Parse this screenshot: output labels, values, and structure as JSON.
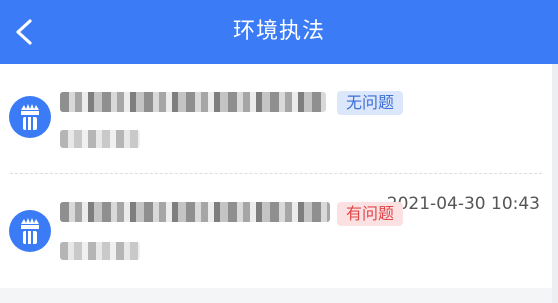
{
  "header": {
    "title": "环境执法"
  },
  "items": [
    {
      "status": "无问题",
      "status_color": "#3b6fd6",
      "time": "2021-04-30 10:43"
    },
    {
      "status": "有问题",
      "status_color": "#e0454a"
    }
  ],
  "colors": {
    "primary": "#3b7bf5"
  },
  "icons": {
    "back": "chevron-left-icon",
    "avatar": "brush-icon"
  }
}
